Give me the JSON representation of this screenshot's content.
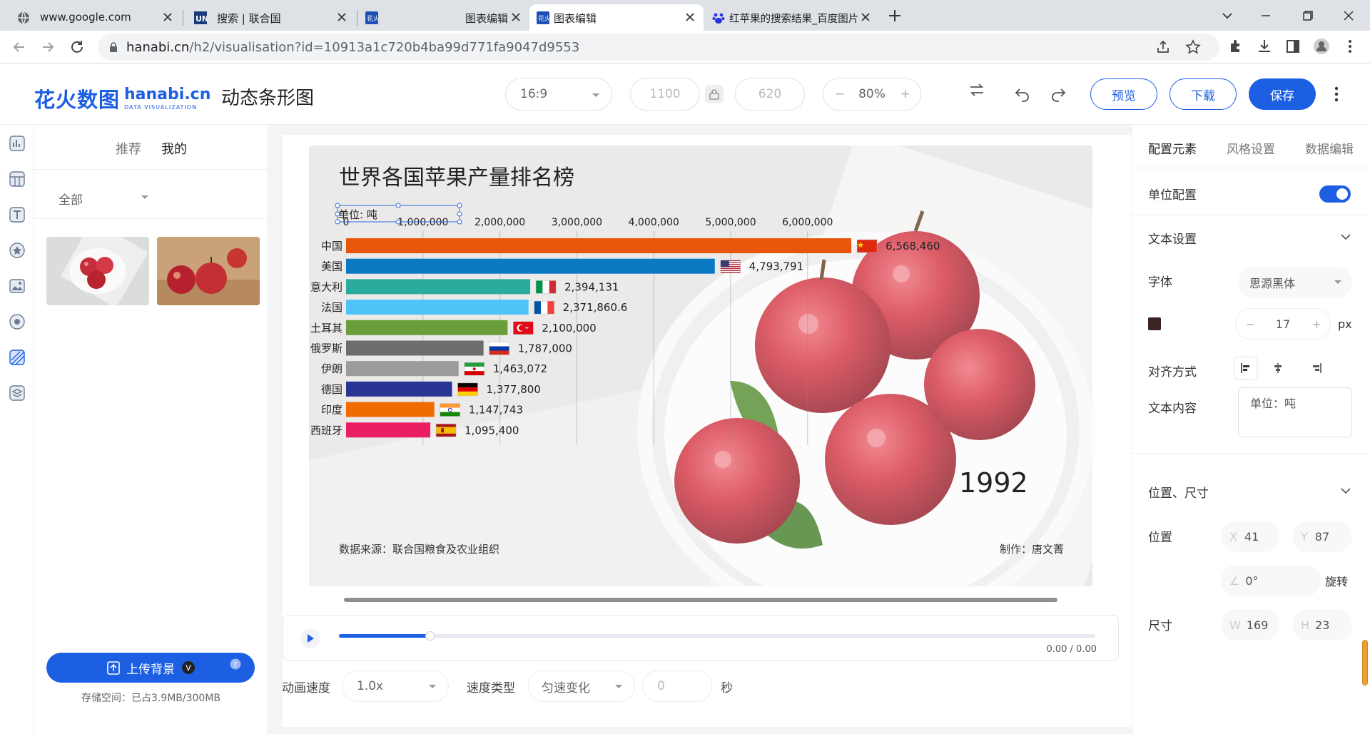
{
  "browser": {
    "tabs": [
      {
        "title": "www.google.com",
        "icon": "globe-icon",
        "active": false
      },
      {
        "title": "搜索 | 联合国",
        "icon": "un-icon",
        "active": false
      },
      {
        "title": "图表编辑",
        "icon": "hanabi-icon",
        "active": false
      },
      {
        "title": "图表编辑",
        "icon": "hanabi-icon",
        "active": true
      },
      {
        "title": "红苹果的搜索结果_百度图片搜索",
        "icon": "baidu-icon",
        "active": false
      }
    ],
    "url_host": "hanabi.cn",
    "url_path": "/h2/visualisation?id=10913a1c720b4ba99d771fa9047d9553"
  },
  "header": {
    "logo_cn": "花火数图",
    "logo_en": "hanabi.cn",
    "logo_sub": "DATA VISUALIZATION",
    "title": "动态条形图",
    "ratio": "16:9",
    "width": "1100",
    "height": "620",
    "zoom": "80%",
    "preview_label": "预览",
    "download_label": "下载",
    "save_label": "保存"
  },
  "left_panel": {
    "tabs": [
      "推荐",
      "我的"
    ],
    "filter": "全部",
    "upload_label": "上传背景",
    "badge": "V",
    "storage": "存储空间：已占3.9MB/300MB"
  },
  "chart_data": {
    "type": "bar",
    "title": "世界各国苹果产量排名榜",
    "unit_label": "单位: 吨",
    "year": "1992",
    "source": "数据来源：联合国粮食及农业组织",
    "author": "制作：唐文菁",
    "xticks": [
      "0",
      "1,000,000",
      "2,000,000",
      "3,000,000",
      "4,000,000",
      "5,000,000",
      "6,000,000"
    ],
    "xlim": [
      0,
      7000000
    ],
    "categories": [
      "中国",
      "美国",
      "意大利",
      "法国",
      "土耳其",
      "俄罗斯",
      "伊朗",
      "德国",
      "印度",
      "西班牙"
    ],
    "values": [
      6568460,
      4793791,
      2394131,
      2371860.6,
      2100000,
      1787000,
      1463072,
      1377800,
      1147743,
      1095400
    ],
    "value_labels": [
      "6,568,460",
      "4,793,791",
      "2,394,131",
      "2,371,860.6",
      "2,100,000",
      "1,787,000",
      "1,463,072",
      "1,377,800",
      "1,147,743",
      "1,095,400"
    ],
    "colors": [
      "#e8560c",
      "#0b78c2",
      "#2aab9c",
      "#4fc3f7",
      "#6a9e3a",
      "#6d6d6d",
      "#9b9b9b",
      "#283593",
      "#ef6c00",
      "#e91e63"
    ],
    "grid": true
  },
  "playback": {
    "time": "0.00 / 0.00",
    "progress": 0.12,
    "speed_label": "动画速度",
    "speed": "1.0x",
    "speed_type_label": "速度类型",
    "speed_type": "匀速变化",
    "duration": "0",
    "duration_unit": "秒"
  },
  "right_panel": {
    "tabs": [
      "配置元素",
      "风格设置",
      "数据编辑"
    ],
    "unit_config": "单位配置",
    "text_settings": "文本设置",
    "font_label": "字体",
    "font": "思源黑体",
    "color": "#3b2323",
    "font_size": "17",
    "font_unit": "px",
    "align_label": "对齐方式",
    "content_label": "文本内容",
    "content": "单位：吨",
    "pos_size_label": "位置、尺寸",
    "pos_label": "位置",
    "x_label": "X",
    "x": "41",
    "y_label": "Y",
    "y": "87",
    "rotate": "0°",
    "rotate_label": "旋转",
    "size_label": "尺寸",
    "w_label": "W",
    "w": "169",
    "h_label": "H",
    "h": "23"
  }
}
